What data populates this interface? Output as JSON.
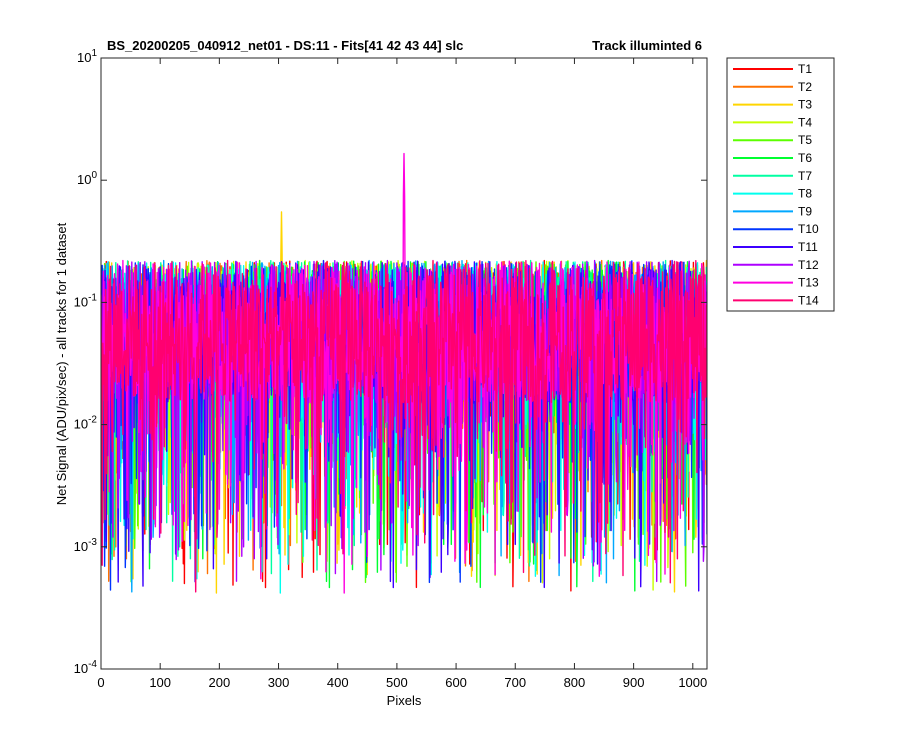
{
  "chart_data": {
    "type": "line",
    "title": "BS_20200205_040912_net01 - DS:11 - Fits[41  42  43  44]   slc",
    "title_right": "Track illuminted 6",
    "xlabel": "Pixels",
    "ylabel": "Net Signal (ADU/pix/sec) - all tracks for 1 dataset",
    "xlim": [
      0,
      1024
    ],
    "ylim": [
      0.0001,
      10
    ],
    "yscale": "log",
    "xticks": [
      0,
      100,
      200,
      300,
      400,
      500,
      600,
      700,
      800,
      900,
      1000
    ],
    "xtick_labels": [
      "0",
      "100",
      "200",
      "300",
      "400",
      "500",
      "600",
      "700",
      "800",
      "900",
      "1000"
    ],
    "yticks": [
      {
        "base": "10",
        "exp": "-4",
        "value": 0.0001
      },
      {
        "base": "10",
        "exp": "-3",
        "value": 0.001
      },
      {
        "base": "10",
        "exp": "-2",
        "value": 0.01
      },
      {
        "base": "10",
        "exp": "-1",
        "value": 0.1
      },
      {
        "base": "10",
        "exp": "0",
        "value": 1
      },
      {
        "base": "10",
        "exp": "1",
        "value": 10
      }
    ],
    "grid": false,
    "legend_position": "outside-top-right",
    "noise_model": {
      "median": 0.05,
      "typical_max": 0.22,
      "typical_min": 0.0004
    },
    "annotations": [
      {
        "series": "T3",
        "x": 305,
        "y": 0.55
      },
      {
        "series": "T13",
        "x": 512,
        "y": 1.65
      }
    ],
    "series": [
      {
        "name": "T1",
        "color": "#ff0000"
      },
      {
        "name": "T2",
        "color": "#ff7200"
      },
      {
        "name": "T3",
        "color": "#ffd500"
      },
      {
        "name": "T4",
        "color": "#c8ff00"
      },
      {
        "name": "T5",
        "color": "#5bff00"
      },
      {
        "name": "T6",
        "color": "#00ff30"
      },
      {
        "name": "T7",
        "color": "#00ffa2"
      },
      {
        "name": "T8",
        "color": "#00ffee"
      },
      {
        "name": "T9",
        "color": "#00a8ff"
      },
      {
        "name": "T10",
        "color": "#0036ff"
      },
      {
        "name": "T11",
        "color": "#3c00ff"
      },
      {
        "name": "T12",
        "color": "#ad00ff"
      },
      {
        "name": "T13",
        "color": "#ff00e0"
      },
      {
        "name": "T14",
        "color": "#ff0070"
      }
    ]
  }
}
